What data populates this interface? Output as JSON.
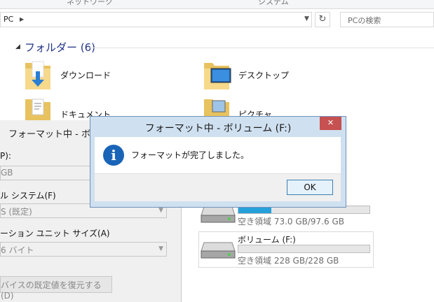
{
  "explorer": {
    "ribbon_tabs": [
      "ネットワーク",
      "システム"
    ],
    "address": "PC",
    "search_placeholder": "PCの検索",
    "folders_title": "フォルダー (6)",
    "folders": [
      {
        "label": "ダウンロード",
        "icon": "downloads-folder-icon"
      },
      {
        "label": "デスクトップ",
        "icon": "desktop-folder-icon"
      },
      {
        "label": "ドキュメント",
        "icon": "documents-folder-icon"
      },
      {
        "label": "ピクチャ",
        "icon": "pictures-folder-icon"
      }
    ],
    "drives": [
      {
        "name": "",
        "free_text": "空き領域 73.0 GB/97.6 GB",
        "used_fraction": 0.252
      },
      {
        "name": "ボリューム (F:)",
        "free_text": "空き領域 228 GB/228 GB",
        "used_fraction": 0.0
      }
    ]
  },
  "format_dialog": {
    "title": "フォーマット中 - ボリ",
    "capacity_label": "P):",
    "capacity_value": "GB",
    "fs_label": "ル システム(F)",
    "fs_value": "S (既定)",
    "alloc_label": "ーション ユニット サイズ(A)",
    "alloc_value": "6 バイト",
    "restore_button": "バイスの既定値を復元する(D)"
  },
  "message_box": {
    "title": "フォーマット中 - ボリューム (F:)",
    "message": "フォーマットが完了しました。",
    "ok_button": "OK",
    "close_symbol": "✕",
    "info_symbol": "i"
  },
  "colors": {
    "accent": "#26a0da",
    "close_red": "#c75050",
    "info_blue": "#1a64b8",
    "title_bar": "#cfe0f0"
  }
}
